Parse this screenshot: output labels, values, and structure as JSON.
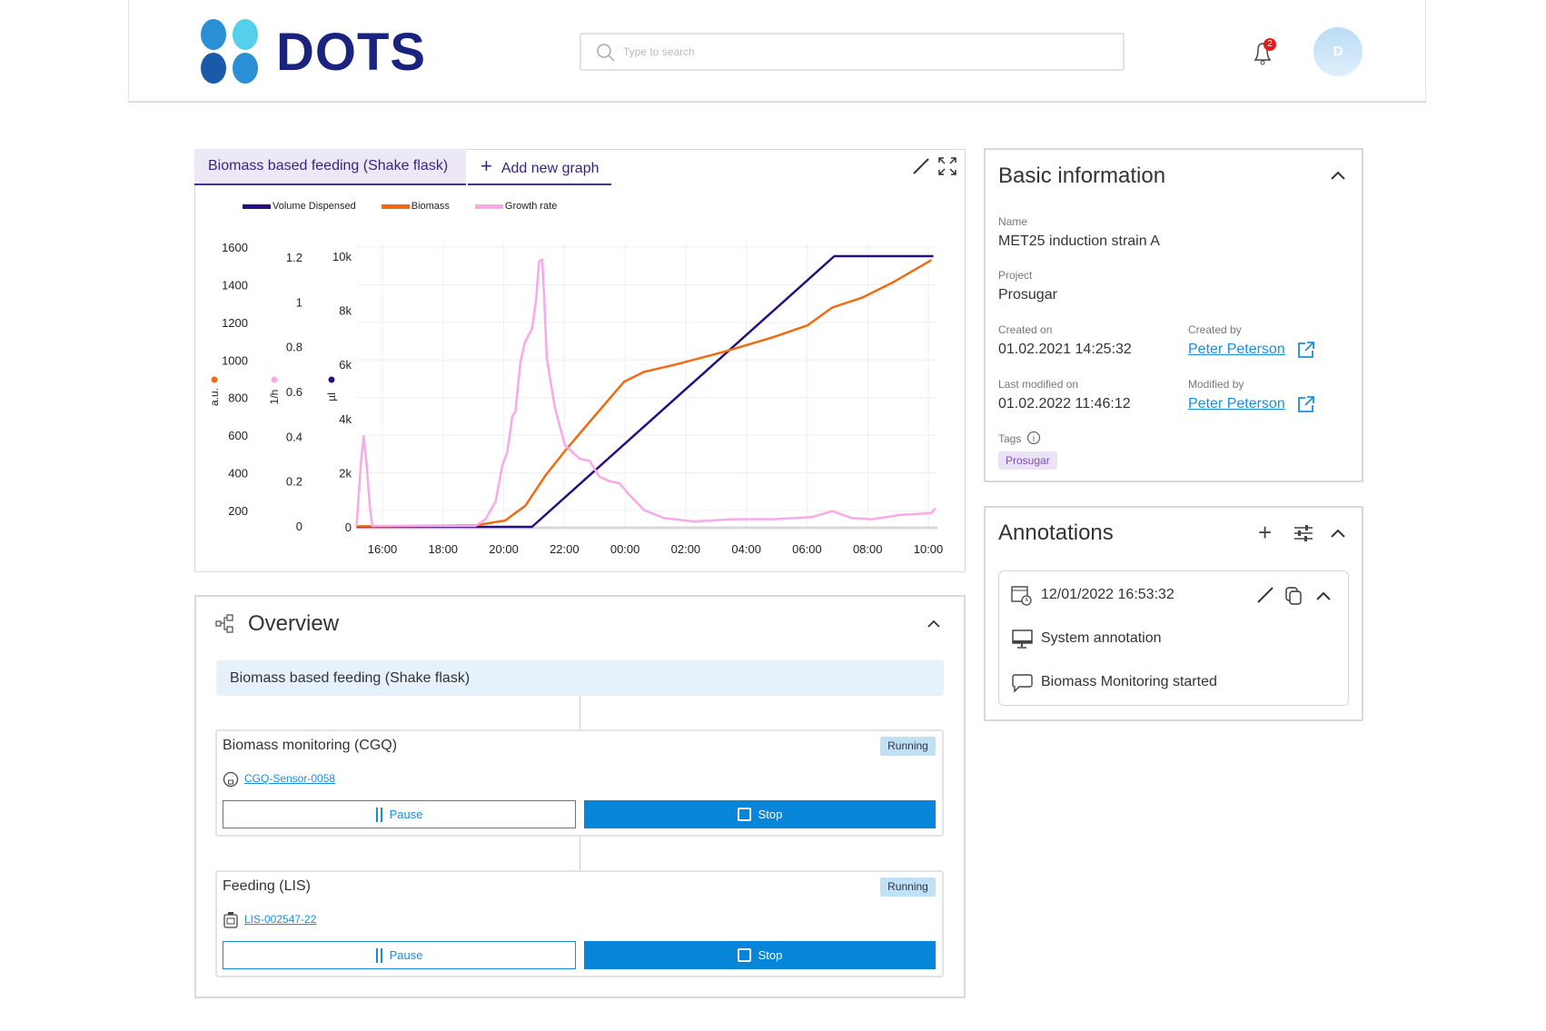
{
  "header": {
    "logo_text": "DOTS",
    "search_placeholder": "Type to search",
    "notification_count": "2",
    "avatar_initial": "D"
  },
  "chart_panel": {
    "tabs": [
      {
        "label": "Biomass based feeding (Shake flask)",
        "active": true
      },
      {
        "label": "Add new graph"
      }
    ]
  },
  "chart_data": {
    "type": "line",
    "legend": [
      "Volume Dispensed",
      "Biomass",
      "Growth rate"
    ],
    "legend_position": "top-left",
    "grid": true,
    "x_ticks": [
      "16:00",
      "18:00",
      "20:00",
      "22:00",
      "00:00",
      "02:00",
      "04:00",
      "06:00",
      "08:00",
      "10:00"
    ],
    "axes": [
      {
        "id": "au",
        "label": "a.u.",
        "color": "#f26a10",
        "ticks": [
          "1600",
          "1400",
          "1200",
          "1000",
          "800",
          "600",
          "400",
          "200"
        ],
        "ylim": [
          200,
          1600
        ]
      },
      {
        "id": "perh",
        "label": "1/h",
        "color": "#f9a8e8",
        "ticks": [
          "1.2",
          "1",
          "0.8",
          "0.6",
          "0.4",
          "0.2",
          "0"
        ],
        "ylim": [
          0,
          1.2
        ]
      },
      {
        "id": "ul",
        "label": "µl",
        "color": "#2a0e80",
        "ticks": [
          "10k",
          "8k",
          "6k",
          "4k",
          "2k",
          "0"
        ],
        "ylim": [
          0,
          10000
        ]
      }
    ],
    "series": [
      {
        "name": "Volume Dispensed",
        "axis": "ul",
        "color": "#2a0e80",
        "points": [
          [
            "15:09",
            0
          ],
          [
            "20:56",
            0
          ],
          [
            "06:54",
            10000
          ],
          [
            "10:10",
            10000
          ]
        ]
      },
      {
        "name": "Biomass",
        "axis": "au",
        "color": "#f26a10",
        "points": [
          [
            "15:09",
            116
          ],
          [
            "16:00",
            116
          ],
          [
            "19:04",
            121
          ],
          [
            "20:03",
            147
          ],
          [
            "20:43",
            226
          ],
          [
            "21:22",
            384
          ],
          [
            "22:01",
            516
          ],
          [
            "22:59",
            700
          ],
          [
            "23:58",
            884
          ],
          [
            "00:38",
            937
          ],
          [
            "01:37",
            974
          ],
          [
            "03:14",
            1042
          ],
          [
            "04:53",
            1121
          ],
          [
            "06:01",
            1184
          ],
          [
            "06:50",
            1279
          ],
          [
            "07:49",
            1331
          ],
          [
            "08:48",
            1410
          ],
          [
            "10:06",
            1531
          ]
        ]
      },
      {
        "name": "Growth rate",
        "axis": "perh",
        "color": "#f9a8e8",
        "points": [
          [
            "15:09",
            0
          ],
          [
            "15:17",
            0.27
          ],
          [
            "15:23",
            0.4
          ],
          [
            "15:29",
            0.27
          ],
          [
            "15:35",
            0.09
          ],
          [
            "15:40",
            0
          ],
          [
            "19:04",
            0
          ],
          [
            "19:24",
            0.03
          ],
          [
            "19:44",
            0.11
          ],
          [
            "19:57",
            0.27
          ],
          [
            "20:07",
            0.33
          ],
          [
            "20:17",
            0.49
          ],
          [
            "20:23",
            0.51
          ],
          [
            "20:33",
            0.73
          ],
          [
            "20:42",
            0.82
          ],
          [
            "20:56",
            0.88
          ],
          [
            "21:04",
            1.01
          ],
          [
            "21:10",
            1.18
          ],
          [
            "21:16",
            1.19
          ],
          [
            "21:20",
            1.02
          ],
          [
            "21:25",
            0.75
          ],
          [
            "21:41",
            0.53
          ],
          [
            "22:01",
            0.36
          ],
          [
            "22:30",
            0.3
          ],
          [
            "22:50",
            0.29
          ],
          [
            "23:09",
            0.22
          ],
          [
            "23:29",
            0.2
          ],
          [
            "23:49",
            0.19
          ],
          [
            "00:08",
            0.14
          ],
          [
            "00:38",
            0.07
          ],
          [
            "01:17",
            0.035
          ],
          [
            "02:16",
            0.02
          ],
          [
            "03:34",
            0.03
          ],
          [
            "04:53",
            0.03
          ],
          [
            "06:11",
            0.04
          ],
          [
            "06:50",
            0.066
          ],
          [
            "07:29",
            0.035
          ],
          [
            "08:08",
            0.03
          ],
          [
            "09:07",
            0.05
          ],
          [
            "10:06",
            0.057
          ],
          [
            "10:14",
            0.08
          ]
        ]
      }
    ]
  },
  "basic_info": {
    "title": "Basic information",
    "name_label": "Name",
    "name": "MET25 induction strain A",
    "project_label": "Project",
    "project": "Prosugar",
    "created_on_label": "Created on",
    "created_on": "01.02.2021 14:25:32",
    "created_by_label": "Created by",
    "created_by": "Peter Peterson",
    "modified_on_label": "Last modified on",
    "modified_on": "01.02.2022 11:46:12",
    "modified_by_label": "Modified by",
    "modified_by": "Peter Peterson",
    "tags_label": "Tags",
    "tags": [
      "Prosugar"
    ]
  },
  "annotations": {
    "title": "Annotations",
    "items": [
      {
        "timestamp": "12/01/2022 16:53:32",
        "type": "System annotation",
        "text": "Biomass Monitoring started"
      }
    ]
  },
  "overview": {
    "title": "Overview",
    "process": "Biomass based feeding (Shake flask)",
    "steps": [
      {
        "title": "Biomass monitoring (CGQ)",
        "status": "Running",
        "device": "CGQ-Sensor-0058",
        "pause": "Pause",
        "stop": "Stop"
      },
      {
        "title": "Feeding (LIS)",
        "status": "Running",
        "device": "LIS-002547-22",
        "pause": "Pause",
        "stop": "Stop"
      }
    ]
  }
}
